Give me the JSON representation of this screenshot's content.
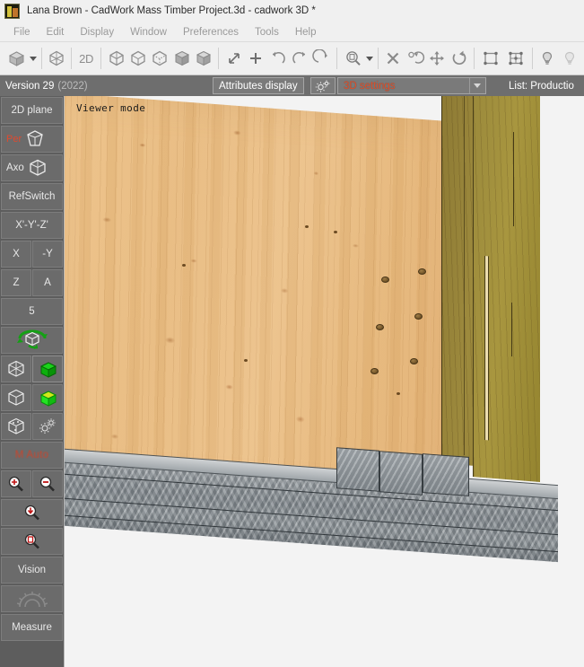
{
  "window": {
    "title": "Lana Brown - CadWork Mass Timber Project.3d - cadwork 3D *",
    "icon": "cadwork-app-icon"
  },
  "menubar": {
    "items": [
      {
        "label": "File"
      },
      {
        "label": "Edit"
      },
      {
        "label": "Display"
      },
      {
        "label": "Window"
      },
      {
        "label": "Preferences"
      },
      {
        "label": "Tools"
      },
      {
        "label": "Help"
      }
    ]
  },
  "toolbar": {
    "groups": [
      {
        "items": [
          {
            "name": "solid-cube-view-icon",
            "label": ""
          },
          {
            "name": "view-dropdown-caret-icon",
            "label": ""
          }
        ]
      },
      {
        "items": [
          {
            "name": "wireframe-cube-icon",
            "label": ""
          },
          {
            "name": "2d-mode-button",
            "label": "2D"
          }
        ]
      },
      {
        "items": [
          {
            "name": "wireframe-cube-axo-icon",
            "label": ""
          },
          {
            "name": "hidden-line-cube-icon",
            "label": ""
          },
          {
            "name": "dashed-hidden-cube-icon",
            "label": ""
          },
          {
            "name": "shaded-cube-icon",
            "label": ""
          },
          {
            "name": "shaded-textured-cube-icon",
            "label": ""
          }
        ]
      },
      {
        "items": [
          {
            "name": "resize-diagonal-icon",
            "label": ""
          },
          {
            "name": "plus-icon",
            "label": ""
          },
          {
            "name": "undo-arrow-icon",
            "label": ""
          },
          {
            "name": "redo-arrow-icon",
            "label": ""
          },
          {
            "name": "flip-arrow-icon",
            "label": ""
          }
        ]
      },
      {
        "items": [
          {
            "name": "zoom-window-icon",
            "label": ""
          },
          {
            "name": "zoom-dropdown-caret-icon",
            "label": ""
          }
        ]
      },
      {
        "items": [
          {
            "name": "delete-cross-icon",
            "label": ""
          },
          {
            "name": "copy-rotate-icon",
            "label": ""
          },
          {
            "name": "move-icon",
            "label": ""
          },
          {
            "name": "rotate-icon",
            "label": ""
          }
        ]
      },
      {
        "items": [
          {
            "name": "select-rectangle-icon",
            "label": ""
          },
          {
            "name": "select-nodes-icon",
            "label": ""
          }
        ]
      },
      {
        "items": [
          {
            "name": "light-bulb-on-icon",
            "label": ""
          },
          {
            "name": "light-bulb-off-icon",
            "label": ""
          }
        ]
      }
    ]
  },
  "infobar": {
    "version_label": "Version 29",
    "version_year": "(2022)",
    "attributes_display_label": "Attributes display",
    "gear_icon": "gear-icon",
    "settings_selected": "3D settings",
    "settings_color": "#e0502a",
    "list_label": "List: Productio"
  },
  "sidebar": {
    "items": [
      {
        "name": "2d-plane-button",
        "label": "2D plane"
      },
      {
        "name": "perspective-button",
        "label": "Per",
        "icon": "perspective-cube-icon"
      },
      {
        "name": "axonometric-button",
        "label": "Axo",
        "icon": "axo-cube-icon"
      },
      {
        "name": "refswitch-button",
        "label": "RefSwitch"
      },
      {
        "name": "axis-xyz-button",
        "label": "X'-Y'-Z'"
      },
      {
        "name": "axis-x-button",
        "label": "X"
      },
      {
        "name": "axis-minus-y-button",
        "label": "-Y"
      },
      {
        "name": "axis-z-button",
        "label": "Z"
      },
      {
        "name": "axis-a-button",
        "label": "A"
      },
      {
        "name": "step-value-button",
        "label": "5"
      },
      {
        "name": "rotate-view-button",
        "label": "",
        "icon": "rotate-cube-green-icon"
      },
      {
        "name": "wireframe-display-button",
        "label": "",
        "icon": "wireframe-cube-icon"
      },
      {
        "name": "solid-green-display-button",
        "label": "",
        "icon": "green-cube-icon"
      },
      {
        "name": "hidden-line-display-button",
        "label": "",
        "icon": "hidden-line-cube-icon"
      },
      {
        "name": "shaded-green-display-button",
        "label": "",
        "icon": "green-cube-bright-icon"
      },
      {
        "name": "point-cube-display-button",
        "label": "",
        "icon": "point-cube-icon"
      },
      {
        "name": "display-settings-button",
        "label": "",
        "icon": "gears-icon"
      },
      {
        "name": "auto-mode-button",
        "label": "M Auto"
      },
      {
        "name": "zoom-in-button",
        "label": "",
        "icon": "zoom-in-icon"
      },
      {
        "name": "zoom-out-button",
        "label": "",
        "icon": "zoom-out-icon"
      },
      {
        "name": "zoom-reset-button",
        "label": "",
        "icon": "zoom-reset-icon"
      },
      {
        "name": "zoom-all-button",
        "label": "",
        "icon": "zoom-all-icon"
      },
      {
        "name": "vision-button",
        "label": "Vision"
      },
      {
        "name": "gear-disabled-button",
        "label": "",
        "icon": "gear-wheel-icon"
      },
      {
        "name": "measure-button",
        "label": "Measure"
      }
    ]
  },
  "viewport": {
    "overlay_text": "Viewer mode",
    "scene_description": "3D model of a mass-timber CLT wall panel meeting a concrete foundation beam",
    "background_color": "#f3f3f3",
    "clt_panel_color": "#e9bd84",
    "glulam_beam_color": "#9d8a3d",
    "concrete_color": "#848b90"
  }
}
